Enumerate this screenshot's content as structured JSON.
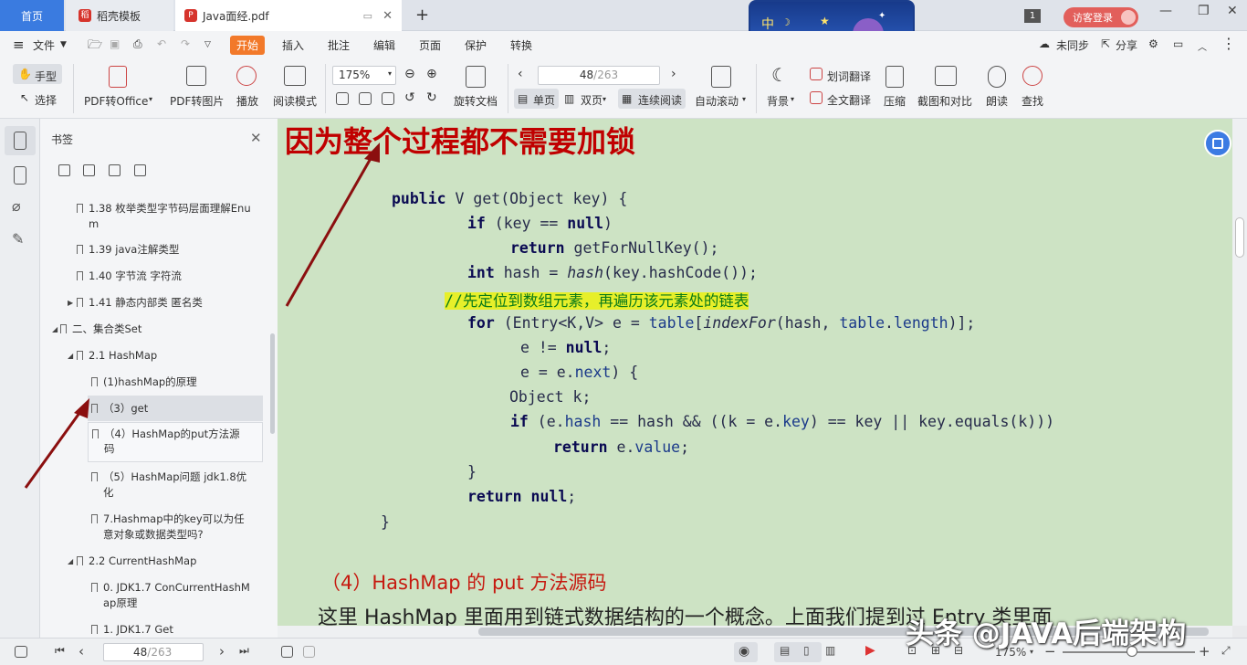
{
  "tabs": {
    "home": "首页",
    "template": "稻壳模板",
    "doc": "Java面经.pdf",
    "add": "+"
  },
  "banner": {
    "text": "中"
  },
  "account": {
    "badge": "1",
    "login": "访客登录"
  },
  "menu": {
    "file": "文件",
    "items": [
      "开始",
      "插入",
      "批注",
      "编辑",
      "页面",
      "保护",
      "转换"
    ],
    "right": [
      "未同步",
      "分享"
    ]
  },
  "toolbar": {
    "hand": "手型",
    "select": "选择",
    "pdf_to_office": "PDF转Office",
    "pdf_to_image": "PDF转图片",
    "play": "播放",
    "read_mode": "阅读模式",
    "zoom": "175%",
    "rotate": "旋转文档",
    "page_current": "48",
    "page_total": "/263",
    "single": "单页",
    "double": "双页",
    "continuous": "连续阅读",
    "auto_scroll": "自动滚动",
    "background": "背景",
    "word_translate": "划词翻译",
    "full_translate": "全文翻译",
    "compress": "压缩",
    "screenshot_compare": "截图和对比",
    "read_aloud": "朗读",
    "find": "查找"
  },
  "sidebar": {
    "title": "书签",
    "items": [
      "1.38 枚举类型字节码层面理解Enu",
      "m",
      "1.39 java注解类型",
      "1.40 字节流 字符流",
      "1.41 静态内部类 匿名类",
      "二、集合类Set",
      "2.1 HashMap",
      "(1)hashMap的原理",
      "（3）get",
      "（4）HashMap的put方法源",
      "码",
      "（5）HashMap问题 jdk1.8优",
      "化",
      "7.Hashmap中的key可以为任",
      "意对象或数据类型吗?",
      "2.2 CurrentHashMap",
      "0. JDK1.7 ConCurrentHashM",
      "ap原理",
      "1. JDK1.7 Get"
    ]
  },
  "document": {
    "heading": "因为整个过程都不需要加锁",
    "code": {
      "l1_a": "public",
      "l1_b": " V get(Object key) {",
      "l2_a": "if",
      "l2_b": " (key == ",
      "l2_c": "null",
      "l2_d": ")",
      "l3_a": "return",
      "l3_b": " getForNullKey();",
      "l4_a": "int",
      "l4_b": " hash = ",
      "l4_c": "hash",
      "l4_d": "(key.hashCode());",
      "l5": "//先定位到数组元素，再遍历该元素处的链表",
      "l6_a": "for",
      "l6_b": " (Entry<K,V> e = ",
      "l6_c": "table",
      "l6_d": "[",
      "l6_e": "indexFor",
      "l6_f": "(hash, ",
      "l6_g": "table",
      "l6_h": ".",
      "l6_i": "length",
      "l6_j": ")];",
      "l7_a": "e != ",
      "l7_b": "null",
      "l7_c": ";",
      "l8_a": "e = e.",
      "l8_b": "next",
      "l8_c": ") {",
      "l9": "Object k;",
      "l10_a": "if",
      "l10_b": " (e.",
      "l10_c": "hash",
      "l10_d": " == hash && ((k = e.",
      "l10_e": "key",
      "l10_f": ") == key || key.equals(k)))",
      "l11_a": "return",
      "l11_b": " e.",
      "l11_c": "value",
      "l11_d": ";",
      "l12": "}",
      "l13_a": "return",
      "l13_b": " ",
      "l13_c": "null",
      "l13_d": ";",
      "l14": "}"
    },
    "subheading": "（4）HashMap 的 put 方法源码",
    "paragraph": "这里 HashMap 里面用到链式数据结构的一个概念。上面我们提到过 Entry 类里面"
  },
  "status": {
    "page_current": "48",
    "page_total": "/263",
    "zoom": "175%"
  },
  "watermark": "头条 @JAVA后端架构",
  "colors": {
    "accent": "#f2792a",
    "doc_bg": "#cde3c4",
    "heading": "#c00000",
    "tab_home": "#3a7be0",
    "highlight": "#e7ef2a"
  }
}
